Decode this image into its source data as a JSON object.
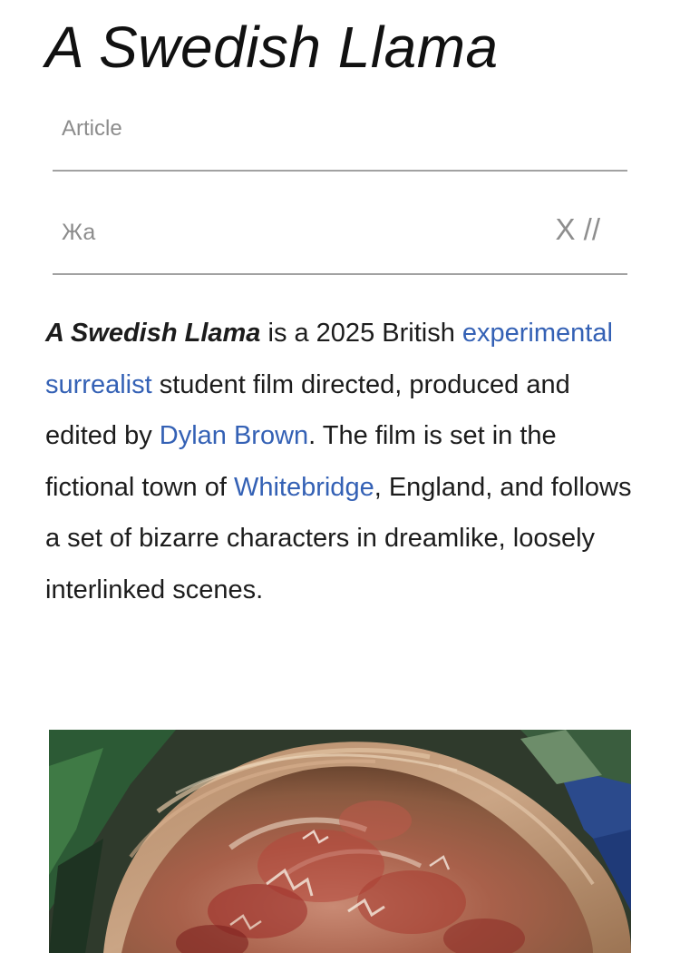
{
  "article": {
    "title": "A Swedish Llama"
  },
  "tabs": {
    "article_label": "Article",
    "language_label": "Жа",
    "tools_label": "X //"
  },
  "lead": {
    "film_name": "A Swedish Llama",
    "text_1": " is a 2025 British ",
    "link_genre": "experimental surrealist",
    "text_2": " student film directed, produced and edited by ",
    "link_director": "Dylan Brown",
    "text_3": ". The film is set in the fictional town of ",
    "link_town": "Whitebridge",
    "text_4": ", England, and follows a set of bizarre characters in dreamlike, loosely interlinked scenes."
  },
  "colors": {
    "link": "#3461b5",
    "text": "#1c1c1c",
    "tab_text": "#8c8c8c",
    "divider": "#a2a2a2"
  }
}
